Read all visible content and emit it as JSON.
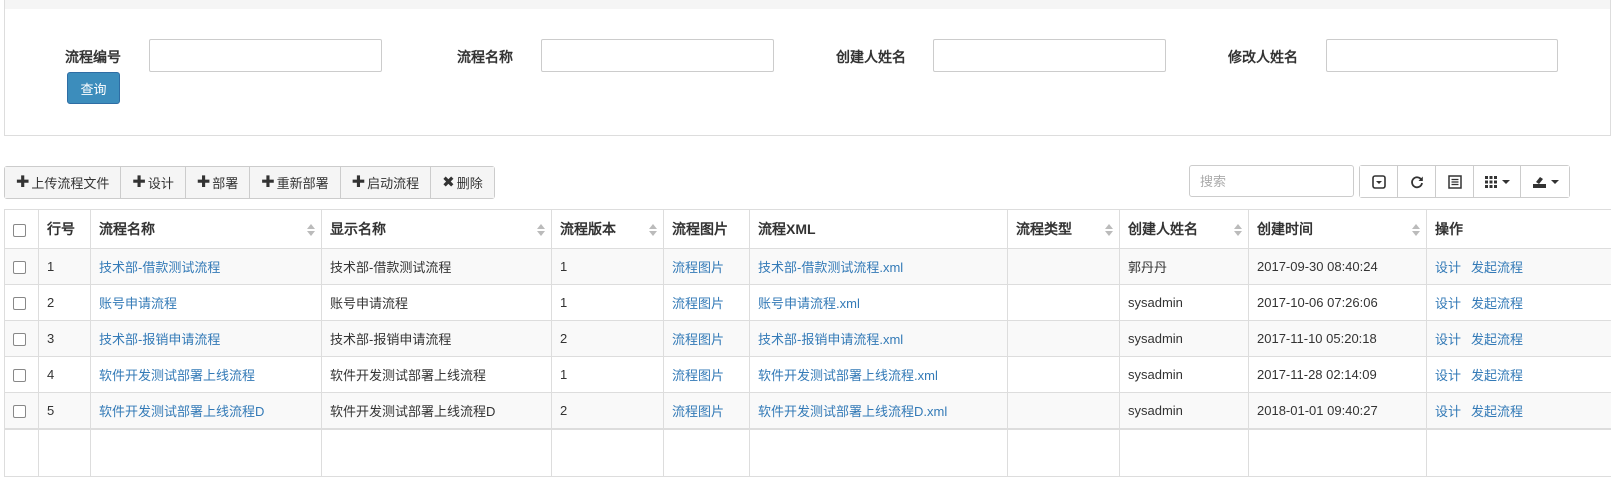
{
  "search": {
    "fields": [
      {
        "label": "流程编号",
        "value": ""
      },
      {
        "label": "流程名称",
        "value": ""
      },
      {
        "label": "创建人姓名",
        "value": ""
      },
      {
        "label": "修改人姓名",
        "value": ""
      }
    ],
    "query_label": "查询"
  },
  "toolbar": {
    "buttons": [
      {
        "icon": "plus-icon",
        "label": "上传流程文件"
      },
      {
        "icon": "plus-icon",
        "label": "设计"
      },
      {
        "icon": "plus-icon",
        "label": "部署"
      },
      {
        "icon": "plus-icon",
        "label": "重新部署"
      },
      {
        "icon": "plus-icon",
        "label": "启动流程"
      },
      {
        "icon": "close-icon",
        "label": "删除"
      }
    ],
    "search_placeholder": "搜索",
    "right_tools": [
      "toggle-icon",
      "refresh-icon",
      "list-icon",
      "columns-icon",
      "export-icon"
    ]
  },
  "table": {
    "columns": [
      "行号",
      "流程名称",
      "显示名称",
      "流程版本",
      "流程图片",
      "流程XML",
      "流程类型",
      "创建人姓名",
      "创建时间",
      "操作"
    ],
    "rows": [
      {
        "no": "1",
        "name": "技术部-借款测试流程",
        "display": "技术部-借款测试流程",
        "version": "1",
        "image": "流程图片",
        "xml": "技术部-借款测试流程.xml",
        "type": "",
        "creator": "郭丹丹",
        "created": "2017-09-30 08:40:24",
        "op1": "设计",
        "op2": "发起流程"
      },
      {
        "no": "2",
        "name": "账号申请流程",
        "display": "账号申请流程",
        "version": "1",
        "image": "流程图片",
        "xml": "账号申请流程.xml",
        "type": "",
        "creator": "sysadmin",
        "created": "2017-10-06 07:26:06",
        "op1": "设计",
        "op2": "发起流程"
      },
      {
        "no": "3",
        "name": "技术部-报销申请流程",
        "display": "技术部-报销申请流程",
        "version": "2",
        "image": "流程图片",
        "xml": "技术部-报销申请流程.xml",
        "type": "",
        "creator": "sysadmin",
        "created": "2017-11-10 05:20:18",
        "op1": "设计",
        "op2": "发起流程"
      },
      {
        "no": "4",
        "name": "软件开发测试部署上线流程",
        "display": "软件开发测试部署上线流程",
        "version": "1",
        "image": "流程图片",
        "xml": "软件开发测试部署上线流程.xml",
        "type": "",
        "creator": "sysadmin",
        "created": "2017-11-28 02:14:09",
        "op1": "设计",
        "op2": "发起流程"
      },
      {
        "no": "5",
        "name": "软件开发测试部署上线流程D",
        "display": "软件开发测试部署上线流程D",
        "version": "2",
        "image": "流程图片",
        "xml": "软件开发测试部署上线流程D.xml",
        "type": "",
        "creator": "sysadmin",
        "created": "2018-01-01 09:40:27",
        "op1": "设计",
        "op2": "发起流程"
      }
    ]
  },
  "colors": {
    "link": "#337ab7",
    "primary_button": "#3c8dbc"
  }
}
